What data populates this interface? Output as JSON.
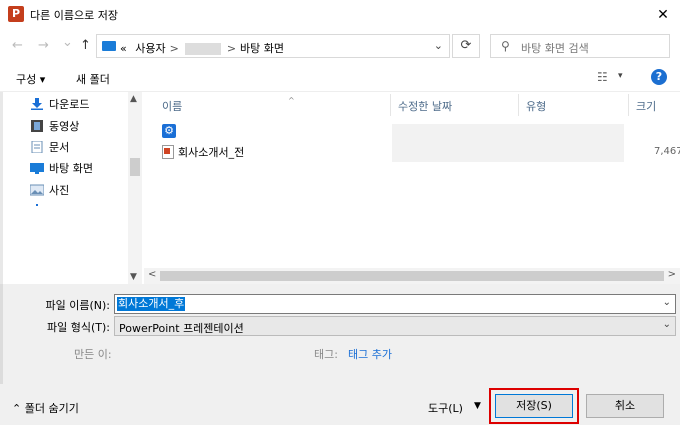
{
  "window": {
    "title": "다른 이름으로 저장",
    "app_icon_letter": "P",
    "close_glyph": "✕"
  },
  "address": {
    "back_glyph": "←",
    "forward_glyph": "→",
    "recent_glyph": "⌄",
    "up_glyph": "↑",
    "crumb_prefix": "«",
    "crumb1": "사용자",
    "crumb3": "바탕 화면",
    "sep": ">",
    "dropdown_glyph": "⌄",
    "refresh_glyph": "⟳"
  },
  "search": {
    "placeholder": "바탕 화면 검색",
    "icon_glyph": "⚲"
  },
  "toolbar": {
    "organize": "구성 ▾",
    "new_folder": "새 폴더",
    "view_glyph": "☷",
    "view_dd": "▾",
    "help": "?"
  },
  "nav": {
    "items": [
      {
        "label": "다운로드",
        "icon": "download-icon",
        "color": "#1a6fd6"
      },
      {
        "label": "동영상",
        "icon": "video-icon",
        "color": "#555555"
      },
      {
        "label": "문서",
        "icon": "document-icon",
        "color": "#6a8fb5"
      },
      {
        "label": "바탕 화면",
        "icon": "desktop-icon",
        "color": "#1a7cd8"
      },
      {
        "label": "사진",
        "icon": "pictures-icon",
        "color": "#6a8fb5"
      }
    ],
    "scroll_up": "▲",
    "scroll_down": "▼"
  },
  "columns": {
    "name": "이름",
    "modified": "수정한 날짜",
    "type": "유형",
    "size": "크기",
    "sort_glyph": "^"
  },
  "files": [
    {
      "name": "",
      "icon": "settings-app-icon"
    },
    {
      "name": "회사소개서_전",
      "icon": "pptx-file-icon",
      "size": "7,467"
    }
  ],
  "hscroll": {
    "left": "<",
    "right": ">"
  },
  "form": {
    "filename_label": "파일 이름(N):",
    "filename_value": "회사소개서_후",
    "filetype_label": "파일 형식(T):",
    "filetype_value": "PowerPoint 프레젠테이션",
    "author_label": "만든 이:",
    "tags_label": "태그:",
    "tags_add": "태그 추가",
    "dd_glyph": "⌄"
  },
  "footer": {
    "hide_folders": "⌃  폴더 숨기기",
    "tools": "도구(L)",
    "tools_dd": "▼",
    "save": "저장(S)",
    "cancel": "취소"
  }
}
